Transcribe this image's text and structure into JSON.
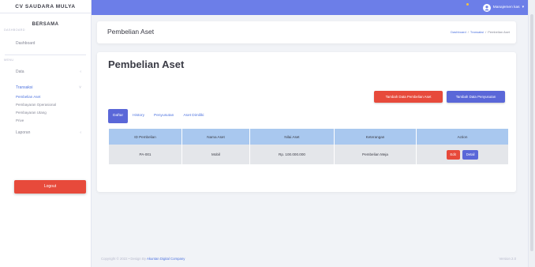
{
  "sidebar": {
    "brand": "CV SAUDARA MULYA",
    "brand_sub": "BERSAMA",
    "heading_dashboard": "DASHBOARD",
    "dashboard": "Dashboard",
    "heading_menu": "MENU",
    "data": "Data",
    "transaksi": "Transaksi",
    "sub_items": [
      "Pembelian Aset",
      "Pembayaran Operasional",
      "Pembayaran Utang",
      "Prive"
    ],
    "laporan": "Laporan",
    "logout": "Logout",
    "chev_icon": "‹"
  },
  "topbar": {
    "user_name": "Manajemen kas",
    "caret": "▾"
  },
  "header": {
    "title": "Pembelian Aset",
    "breadcrumb": [
      "Dashboard",
      "/",
      "Transaksi",
      "/",
      "Pembelian Aset"
    ]
  },
  "card": {
    "title": "Pembelian Aset",
    "btn_add": "Tambah Data Pembelian Aset",
    "btn_depr": "Tambah Data Penyusutan",
    "tabs": [
      "Daftar",
      "History",
      "Penyusutan",
      "Aset Dimiliki"
    ]
  },
  "table": {
    "headers": [
      "ID Pembelian",
      "Nama Aset",
      "Nilai Aset",
      "Keterangan",
      "Action"
    ],
    "rows": [
      [
        "PA-001",
        "Mobil",
        "Rp. 100.000.000",
        "Pembelian Meja"
      ]
    ],
    "edit": "Edit",
    "detail": "Detail"
  },
  "footer": {
    "copyright": "Copyright © 2022 • Design By",
    "company": "Akuntan Digital Company",
    "version": "Version 2.0"
  },
  "colors": {
    "primary": "#4e73df",
    "topbar": "#6c7ee8",
    "danger": "#e74a3b",
    "table_head": "#a9c8ef"
  }
}
